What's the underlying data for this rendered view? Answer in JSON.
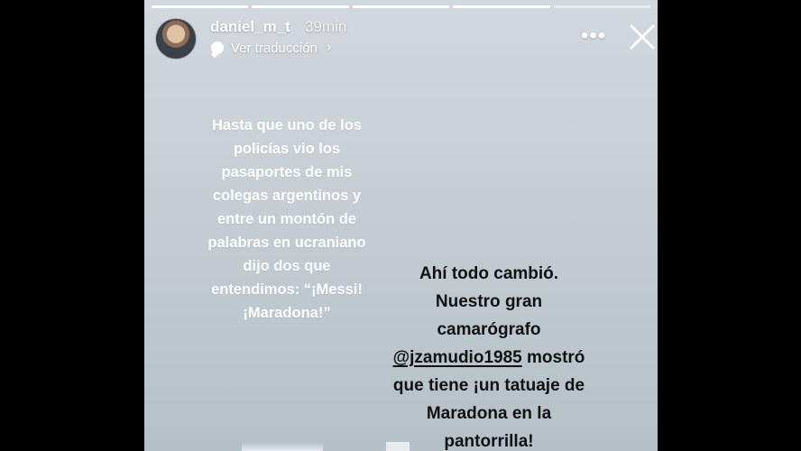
{
  "story": {
    "username": "daniel_m_t",
    "time": "39min",
    "translate_label": "Ver traducción",
    "progress_segments": 5,
    "progress_completed": 4,
    "text_white_lines": [
      "Hasta que uno de los",
      "policías vio los",
      "pasaportes de mis",
      "colegas argentinos y",
      "entre un montón de",
      "palabras en ucraniano",
      "dijo dos que",
      "entendimos: “¡Messi!",
      "¡Maradona!”"
    ],
    "text_black": {
      "line1": "Ahí todo cambió.",
      "line2": "Nuestro gran",
      "line3": "camarógrafo",
      "mention": "@jzamudio1985",
      "after_mention": " mostró",
      "line5": "que tiene ¡un tatuaje de",
      "line6": "Maradona en la",
      "line7": "pantorrilla!"
    }
  },
  "icons": {
    "more": "more-options-icon",
    "close": "close-icon",
    "translate": "speech-bubble-icon",
    "chevron": "chevron-right-icon"
  },
  "colors": {
    "background_outer": "#000000",
    "story_bg_top": "#d2d8dd",
    "story_bg_bottom": "#b6c0c7",
    "white_text": "#ffffff",
    "black_text": "#111111"
  }
}
